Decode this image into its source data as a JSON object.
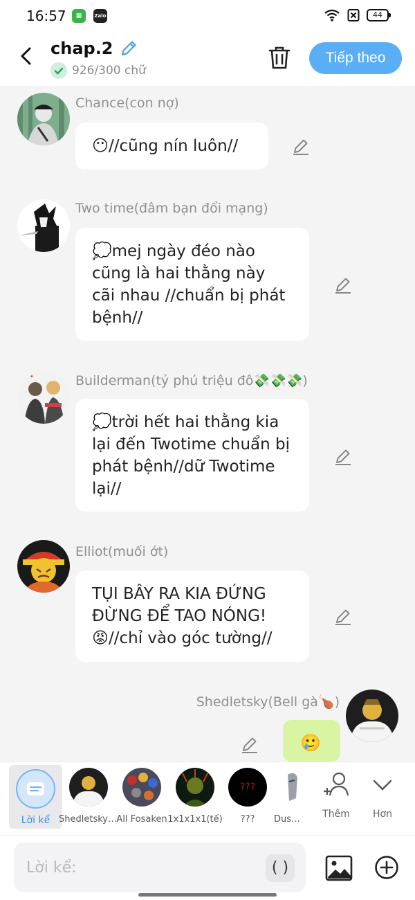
{
  "status_bar": {
    "time": "16:57",
    "battery": "44",
    "apps": [
      "apps-icon",
      "Zalo"
    ]
  },
  "header": {
    "title": "chap.2",
    "word_count": "926/300 chữ",
    "next_label": "Tiếp theo"
  },
  "messages": [
    {
      "sender": "Chance(con nợ)",
      "text": "😶//cũng nín luôn//",
      "avatar": "chance-avatar"
    },
    {
      "sender": "Two time(đâm bạn đổi mạng)",
      "text": "💭mej ngày đéo nào cũng là hai thằng này cãi nhau //chuẩn bị phát bệnh//",
      "avatar": "twotime-avatar"
    },
    {
      "sender": "Builderman(tỷ phú triệu đô💸💸💸)",
      "text": "💭trời hết hai thằng kia lại đến Twotime chuẩn bị phát bệnh//dữ Twotime lại//",
      "avatar": "builderman-avatar"
    },
    {
      "sender": "Elliot(muối ớt)",
      "text": "TỤI BÂY RA KIA ĐỨNG ĐỪNG ĐỂ TAO NÓNG!😡//chỉ vào góc tường//",
      "avatar": "elliot-avatar"
    },
    {
      "sender": "Shedletsky(Bell gà🍗)",
      "text": "🥲",
      "avatar": "shedletsky-avatar"
    }
  ],
  "characters": [
    {
      "label": "Lời kể",
      "selected": true
    },
    {
      "label": "Shedletsky(Bell gà🍗)"
    },
    {
      "label": "All Fosaken"
    },
    {
      "label": "1x1x1x1(tế)"
    },
    {
      "label": "???"
    },
    {
      "label": "Dusekkar"
    }
  ],
  "char_avatar_text": "???",
  "tools": {
    "more_label": "Thêm",
    "collapse_label": "Hơn"
  },
  "input": {
    "placeholder": "Lời kể:",
    "paren_label": "( )"
  },
  "colors": {
    "accent": "#5aaef6",
    "right_bubble": "#d9f5a4",
    "background": "#f4f4f5"
  }
}
